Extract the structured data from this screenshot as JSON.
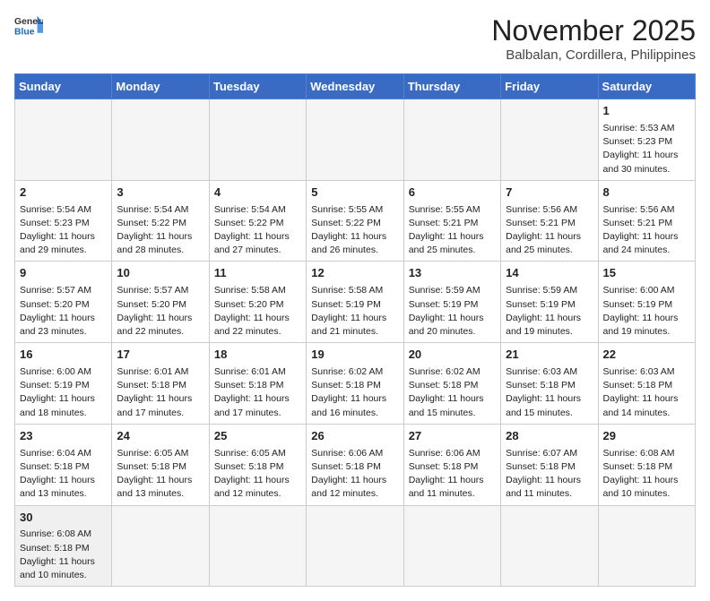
{
  "header": {
    "logo_general": "General",
    "logo_blue": "Blue",
    "month": "November 2025",
    "location": "Balbalan, Cordillera, Philippines"
  },
  "days_of_week": [
    "Sunday",
    "Monday",
    "Tuesday",
    "Wednesday",
    "Thursday",
    "Friday",
    "Saturday"
  ],
  "weeks": [
    [
      {
        "day": "",
        "sunrise": "",
        "sunset": "",
        "daylight": ""
      },
      {
        "day": "",
        "sunrise": "",
        "sunset": "",
        "daylight": ""
      },
      {
        "day": "",
        "sunrise": "",
        "sunset": "",
        "daylight": ""
      },
      {
        "day": "",
        "sunrise": "",
        "sunset": "",
        "daylight": ""
      },
      {
        "day": "",
        "sunrise": "",
        "sunset": "",
        "daylight": ""
      },
      {
        "day": "",
        "sunrise": "",
        "sunset": "",
        "daylight": ""
      },
      {
        "day": "1",
        "sunrise": "Sunrise: 5:53 AM",
        "sunset": "Sunset: 5:23 PM",
        "daylight": "Daylight: 11 hours and 30 minutes."
      }
    ],
    [
      {
        "day": "2",
        "sunrise": "Sunrise: 5:54 AM",
        "sunset": "Sunset: 5:23 PM",
        "daylight": "Daylight: 11 hours and 29 minutes."
      },
      {
        "day": "3",
        "sunrise": "Sunrise: 5:54 AM",
        "sunset": "Sunset: 5:22 PM",
        "daylight": "Daylight: 11 hours and 28 minutes."
      },
      {
        "day": "4",
        "sunrise": "Sunrise: 5:54 AM",
        "sunset": "Sunset: 5:22 PM",
        "daylight": "Daylight: 11 hours and 27 minutes."
      },
      {
        "day": "5",
        "sunrise": "Sunrise: 5:55 AM",
        "sunset": "Sunset: 5:22 PM",
        "daylight": "Daylight: 11 hours and 26 minutes."
      },
      {
        "day": "6",
        "sunrise": "Sunrise: 5:55 AM",
        "sunset": "Sunset: 5:21 PM",
        "daylight": "Daylight: 11 hours and 25 minutes."
      },
      {
        "day": "7",
        "sunrise": "Sunrise: 5:56 AM",
        "sunset": "Sunset: 5:21 PM",
        "daylight": "Daylight: 11 hours and 25 minutes."
      },
      {
        "day": "8",
        "sunrise": "Sunrise: 5:56 AM",
        "sunset": "Sunset: 5:21 PM",
        "daylight": "Daylight: 11 hours and 24 minutes."
      }
    ],
    [
      {
        "day": "9",
        "sunrise": "Sunrise: 5:57 AM",
        "sunset": "Sunset: 5:20 PM",
        "daylight": "Daylight: 11 hours and 23 minutes."
      },
      {
        "day": "10",
        "sunrise": "Sunrise: 5:57 AM",
        "sunset": "Sunset: 5:20 PM",
        "daylight": "Daylight: 11 hours and 22 minutes."
      },
      {
        "day": "11",
        "sunrise": "Sunrise: 5:58 AM",
        "sunset": "Sunset: 5:20 PM",
        "daylight": "Daylight: 11 hours and 22 minutes."
      },
      {
        "day": "12",
        "sunrise": "Sunrise: 5:58 AM",
        "sunset": "Sunset: 5:19 PM",
        "daylight": "Daylight: 11 hours and 21 minutes."
      },
      {
        "day": "13",
        "sunrise": "Sunrise: 5:59 AM",
        "sunset": "Sunset: 5:19 PM",
        "daylight": "Daylight: 11 hours and 20 minutes."
      },
      {
        "day": "14",
        "sunrise": "Sunrise: 5:59 AM",
        "sunset": "Sunset: 5:19 PM",
        "daylight": "Daylight: 11 hours and 19 minutes."
      },
      {
        "day": "15",
        "sunrise": "Sunrise: 6:00 AM",
        "sunset": "Sunset: 5:19 PM",
        "daylight": "Daylight: 11 hours and 19 minutes."
      }
    ],
    [
      {
        "day": "16",
        "sunrise": "Sunrise: 6:00 AM",
        "sunset": "Sunset: 5:19 PM",
        "daylight": "Daylight: 11 hours and 18 minutes."
      },
      {
        "day": "17",
        "sunrise": "Sunrise: 6:01 AM",
        "sunset": "Sunset: 5:18 PM",
        "daylight": "Daylight: 11 hours and 17 minutes."
      },
      {
        "day": "18",
        "sunrise": "Sunrise: 6:01 AM",
        "sunset": "Sunset: 5:18 PM",
        "daylight": "Daylight: 11 hours and 17 minutes."
      },
      {
        "day": "19",
        "sunrise": "Sunrise: 6:02 AM",
        "sunset": "Sunset: 5:18 PM",
        "daylight": "Daylight: 11 hours and 16 minutes."
      },
      {
        "day": "20",
        "sunrise": "Sunrise: 6:02 AM",
        "sunset": "Sunset: 5:18 PM",
        "daylight": "Daylight: 11 hours and 15 minutes."
      },
      {
        "day": "21",
        "sunrise": "Sunrise: 6:03 AM",
        "sunset": "Sunset: 5:18 PM",
        "daylight": "Daylight: 11 hours and 15 minutes."
      },
      {
        "day": "22",
        "sunrise": "Sunrise: 6:03 AM",
        "sunset": "Sunset: 5:18 PM",
        "daylight": "Daylight: 11 hours and 14 minutes."
      }
    ],
    [
      {
        "day": "23",
        "sunrise": "Sunrise: 6:04 AM",
        "sunset": "Sunset: 5:18 PM",
        "daylight": "Daylight: 11 hours and 13 minutes."
      },
      {
        "day": "24",
        "sunrise": "Sunrise: 6:05 AM",
        "sunset": "Sunset: 5:18 PM",
        "daylight": "Daylight: 11 hours and 13 minutes."
      },
      {
        "day": "25",
        "sunrise": "Sunrise: 6:05 AM",
        "sunset": "Sunset: 5:18 PM",
        "daylight": "Daylight: 11 hours and 12 minutes."
      },
      {
        "day": "26",
        "sunrise": "Sunrise: 6:06 AM",
        "sunset": "Sunset: 5:18 PM",
        "daylight": "Daylight: 11 hours and 12 minutes."
      },
      {
        "day": "27",
        "sunrise": "Sunrise: 6:06 AM",
        "sunset": "Sunset: 5:18 PM",
        "daylight": "Daylight: 11 hours and 11 minutes."
      },
      {
        "day": "28",
        "sunrise": "Sunrise: 6:07 AM",
        "sunset": "Sunset: 5:18 PM",
        "daylight": "Daylight: 11 hours and 11 minutes."
      },
      {
        "day": "29",
        "sunrise": "Sunrise: 6:08 AM",
        "sunset": "Sunset: 5:18 PM",
        "daylight": "Daylight: 11 hours and 10 minutes."
      }
    ],
    [
      {
        "day": "30",
        "sunrise": "Sunrise: 6:08 AM",
        "sunset": "Sunset: 5:18 PM",
        "daylight": "Daylight: 11 hours and 10 minutes."
      },
      {
        "day": "",
        "sunrise": "",
        "sunset": "",
        "daylight": ""
      },
      {
        "day": "",
        "sunrise": "",
        "sunset": "",
        "daylight": ""
      },
      {
        "day": "",
        "sunrise": "",
        "sunset": "",
        "daylight": ""
      },
      {
        "day": "",
        "sunrise": "",
        "sunset": "",
        "daylight": ""
      },
      {
        "day": "",
        "sunrise": "",
        "sunset": "",
        "daylight": ""
      },
      {
        "day": "",
        "sunrise": "",
        "sunset": "",
        "daylight": ""
      }
    ]
  ]
}
